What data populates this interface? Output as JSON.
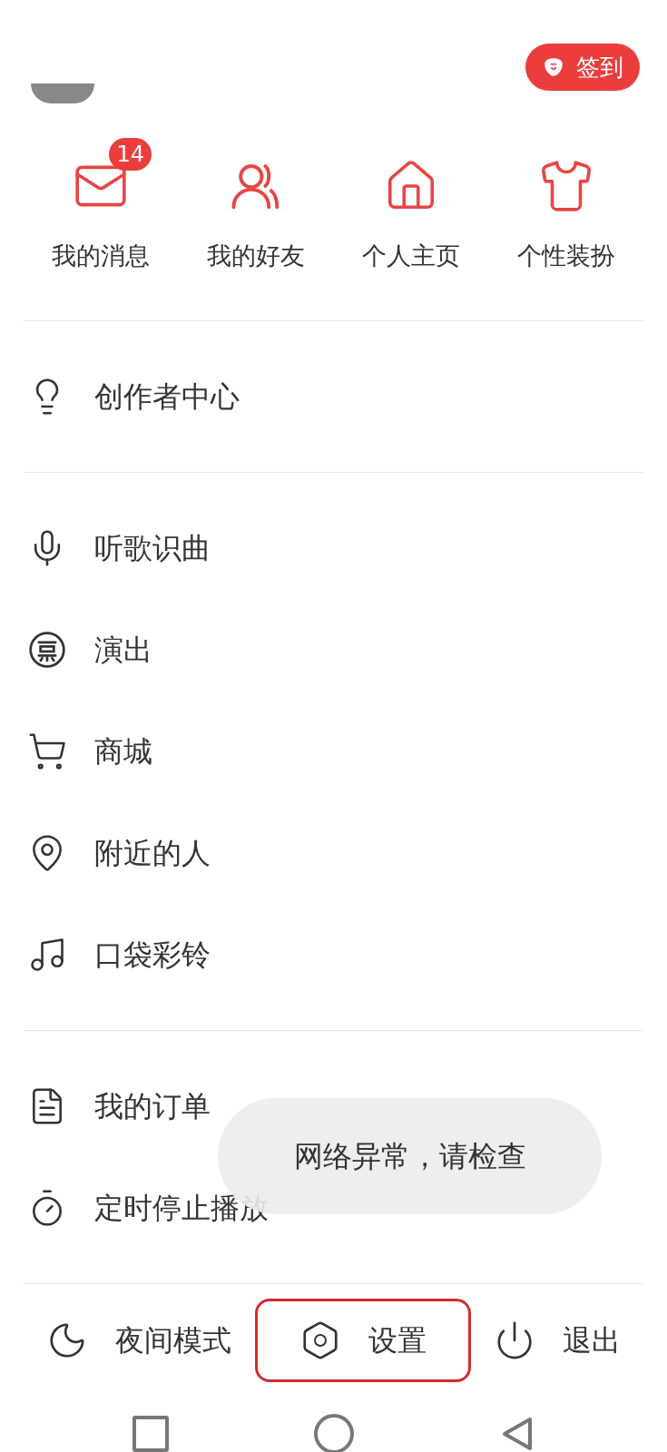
{
  "header": {
    "sign_in": {
      "label": "签到"
    }
  },
  "quick_links": [
    {
      "kind": "mail",
      "label": "我的消息",
      "badge": "14"
    },
    {
      "kind": "friends",
      "label": "我的好友"
    },
    {
      "kind": "home",
      "label": "个人主页"
    },
    {
      "kind": "shirt",
      "label": "个性装扮"
    }
  ],
  "menu_sections": [
    [
      {
        "kind": "bulb",
        "label": "创作者中心"
      }
    ],
    [
      {
        "kind": "mic",
        "label": "听歌识曲"
      },
      {
        "kind": "ticket",
        "label": "演出"
      },
      {
        "kind": "cart",
        "label": "商城"
      },
      {
        "kind": "pin",
        "label": "附近的人"
      },
      {
        "kind": "music",
        "label": "口袋彩铃"
      }
    ],
    [
      {
        "kind": "doc",
        "label": "我的订单"
      },
      {
        "kind": "timer",
        "label": "定时停止播放"
      }
    ]
  ],
  "bottom_bar": [
    {
      "kind": "moon",
      "label": "夜间模式",
      "highlighted": false
    },
    {
      "kind": "settings",
      "label": "设置",
      "highlighted": true
    },
    {
      "kind": "power",
      "label": "退出",
      "highlighted": false
    }
  ],
  "toast": {
    "text": "网络异常，请检查"
  }
}
